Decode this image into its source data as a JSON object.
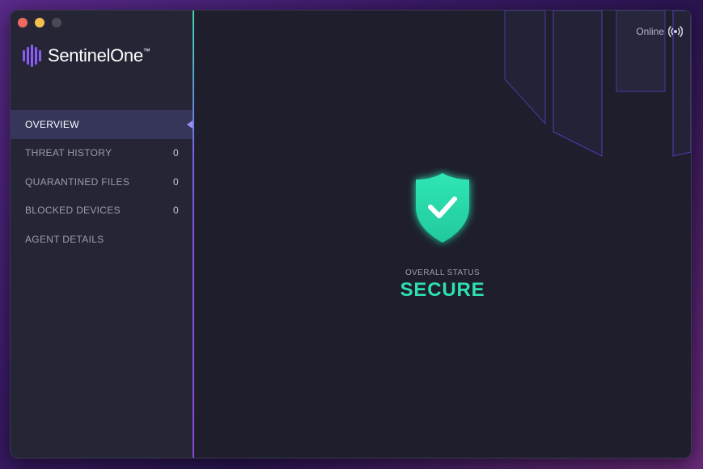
{
  "app": {
    "brand": "SentinelOne",
    "trademark": "™"
  },
  "sidebar": {
    "items": [
      {
        "label": "OVERVIEW",
        "count": "",
        "active": true
      },
      {
        "label": "THREAT HISTORY",
        "count": "0"
      },
      {
        "label": "QUARANTINED FILES",
        "count": "0"
      },
      {
        "label": "BLOCKED DEVICES",
        "count": "0"
      },
      {
        "label": "AGENT DETAILS",
        "count": ""
      }
    ]
  },
  "header": {
    "connection_status": "Online",
    "connection_icon": "broadcast-icon"
  },
  "main": {
    "status_label": "OVERALL STATUS",
    "status_value": "SECURE",
    "status_icon": "shield-check-icon"
  },
  "colors": {
    "accent_green": "#2ee0ad",
    "accent_purple": "#7b5cf0",
    "background": "#1e1e2d",
    "sidebar": "#252536"
  }
}
